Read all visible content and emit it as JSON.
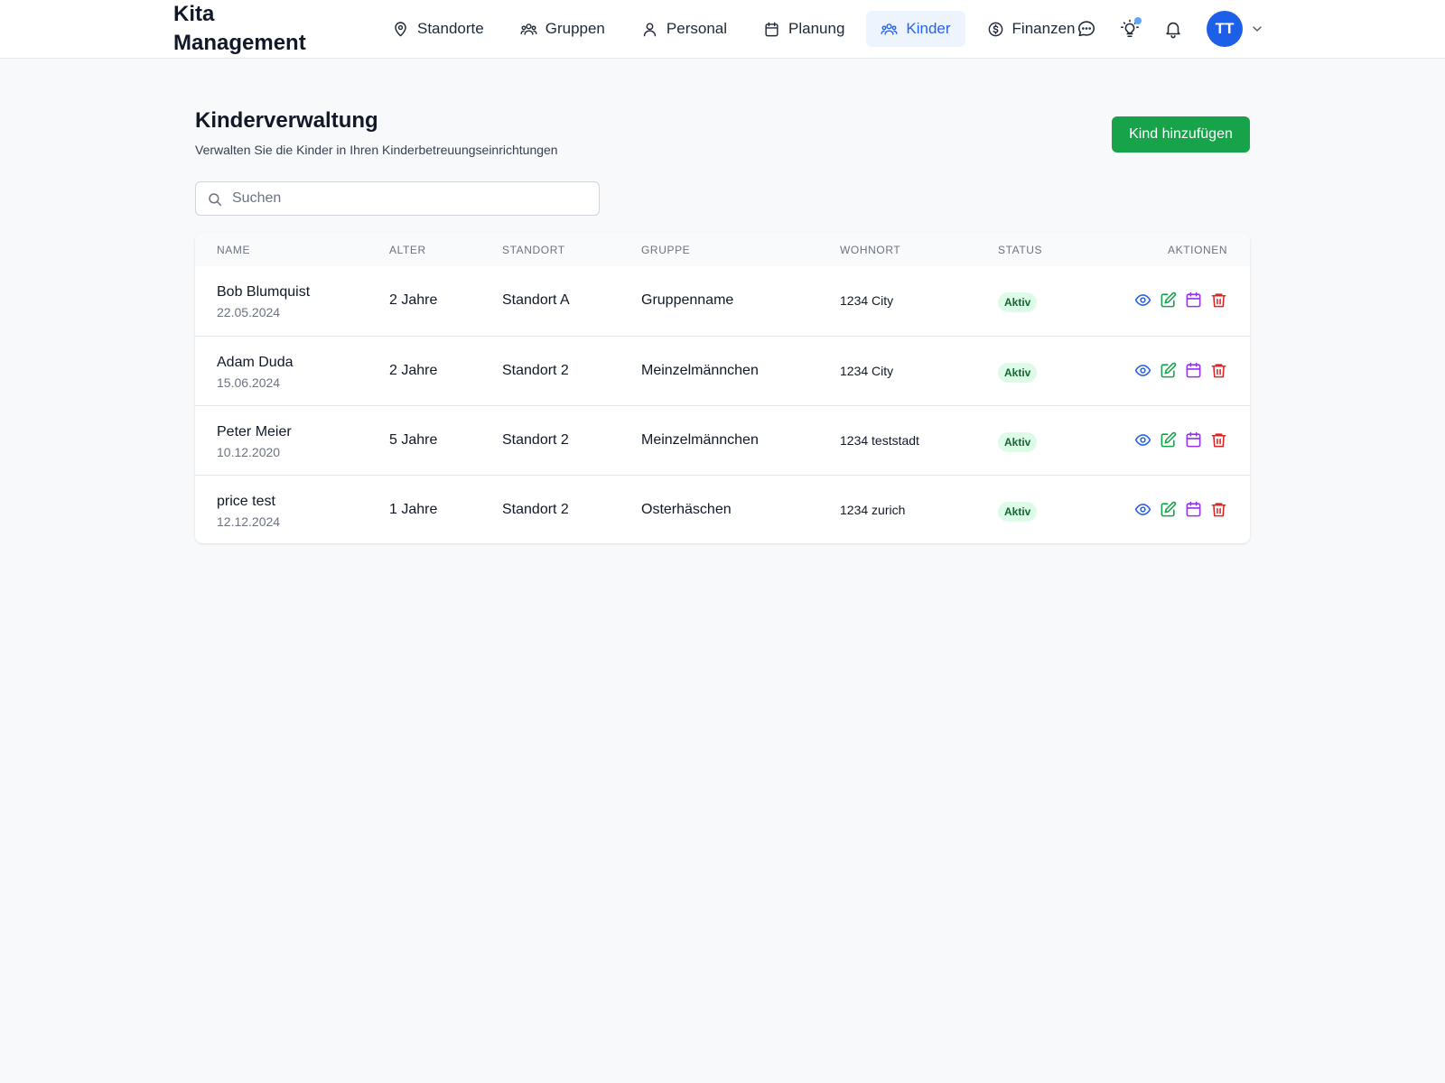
{
  "brand": {
    "line1": "Kita",
    "line2": "Management"
  },
  "nav": {
    "items": [
      {
        "label": "Standorte",
        "icon": "map-pin-icon",
        "active": false
      },
      {
        "label": "Gruppen",
        "icon": "users-group-icon",
        "active": false
      },
      {
        "label": "Personal",
        "icon": "user-icon",
        "active": false
      },
      {
        "label": "Planung",
        "icon": "calendar-icon",
        "active": false
      },
      {
        "label": "Kinder",
        "icon": "users-group-icon",
        "active": true
      },
      {
        "label": "Finanzen",
        "icon": "dollar-circle-icon",
        "active": false
      }
    ],
    "avatar_initials": "TT"
  },
  "page": {
    "title": "Kinderverwaltung",
    "subtitle": "Verwalten Sie die Kinder in Ihren Kinderbetreuungseinrichtungen",
    "add_button": "Kind hinzufügen",
    "search_placeholder": "Suchen"
  },
  "table": {
    "headers": [
      "NAME",
      "ALTER",
      "STANDORT",
      "GRUPPE",
      "WOHNORT",
      "STATUS",
      "AKTIONEN"
    ],
    "rows": [
      {
        "name": "Bob Blumquist",
        "birthdate": "22.05.2024",
        "age": "2 Jahre",
        "location": "Standort A",
        "group": "Gruppenname",
        "residence": "1234 City",
        "status": "Aktiv"
      },
      {
        "name": "Adam Duda",
        "birthdate": "15.06.2024",
        "age": "2 Jahre",
        "location": "Standort 2",
        "group": "Meinzelmännchen",
        "residence": "1234 City",
        "status": "Aktiv"
      },
      {
        "name": "Peter Meier",
        "birthdate": "10.12.2020",
        "age": "5 Jahre",
        "location": "Standort 2",
        "group": "Meinzelmännchen",
        "residence": "1234 teststadt",
        "status": "Aktiv"
      },
      {
        "name": "price test",
        "birthdate": "12.12.2024",
        "age": "1 Jahre",
        "location": "Standort 2",
        "group": "Osterhäschen",
        "residence": "1234 zurich",
        "status": "Aktiv"
      }
    ]
  },
  "colors": {
    "primary": "#2563eb",
    "success": "#16a34a",
    "accent_purple": "#9333ea",
    "danger": "#dc2626"
  }
}
